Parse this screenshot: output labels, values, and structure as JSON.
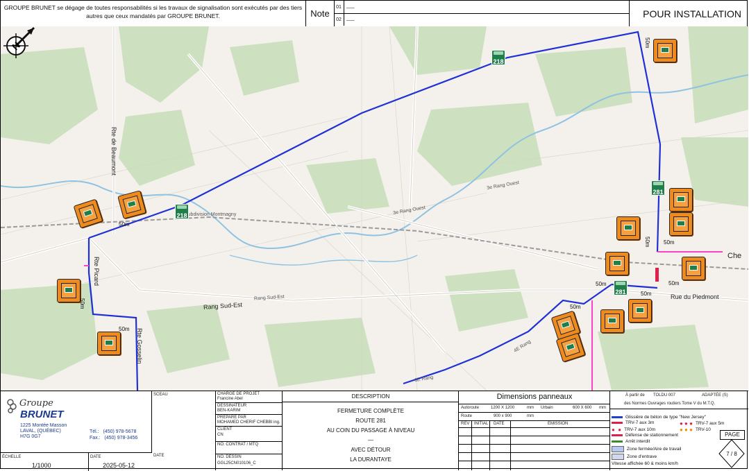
{
  "header": {
    "disclaimer": "GROUPE BRUNET se dégage de toutes responsabilités si les travaux de signalisation sont exécutés par des tiers autres que ceux mandatés par GROUPE BRUNET.",
    "note_label": "Note",
    "note_rows": [
      {
        "num": "01",
        "value": "___"
      },
      {
        "num": "02",
        "value": "___"
      }
    ],
    "status": "POUR INSTALLATION"
  },
  "map": {
    "roads": {
      "rte_beaumont": "Rte de Beaumont",
      "rte_picard": "Rte Picard",
      "rte_gosselin": "Rte Gosselin",
      "rang_sud_est": "Rang Sud-Est",
      "rang_sud_est_small": "Rang Sud-Est",
      "rue_piedmont": "Rue du Piedmont",
      "rang_4e": "4E Rang",
      "rang_6e": "6E Rang",
      "rang_3e": "3e Rang Ouest",
      "chemin": "Che",
      "rang_3e_b": "3e Rang Ouest",
      "railway": "Subdivision Montmagny"
    },
    "route_shields": [
      "218",
      "218",
      "281",
      "281"
    ],
    "dimensions": [
      "50m",
      "50m",
      "50m",
      "50m",
      "50m",
      "50m",
      "50m",
      "50m",
      "50m",
      "50m"
    ],
    "compass_label": "N"
  },
  "title_block": {
    "logo_word": "Groupe",
    "logo_brand": "BRUNET",
    "address_1": "1225 Montée Masson",
    "address_2": "LAVAL, (QUÉBEC)",
    "address_3": "H7G 0G7",
    "tel_label": "Tél.:",
    "tel": "(450) 978-5678",
    "fax_label": "Fax.:",
    "fax": "(450) 978-3456",
    "echelle_label": "ÉCHELLE",
    "echelle": "1/1000",
    "date_label": "DATE",
    "date": "2025-05-12",
    "sceau_label": "SCEAU",
    "date2_label": "DATE",
    "charge_label": "CHARGÉ DE PROJET",
    "charge": "Francine Abel",
    "dessinateur_label": "DESSINATEUR",
    "dessinateur": "BEN-KARIM",
    "prepare_label": "PRÉPARÉ PAR",
    "prepare": "MOHAMED CHERIF CHEBBI ing.",
    "client_label": "CLIENT",
    "client": "CN",
    "contrat_label": "NO. CONTRAT / MTQ",
    "dessin_label": "NO. DESSIN",
    "dessin": "GGL25CN010106_C",
    "description_label": "DESCRIPTION",
    "description_lines": [
      "FERMETURE COMPLÈTE",
      "ROUTE 281",
      "AU COIN DU PASSAGE À NIVEAU",
      "—",
      "AVEC DÉTOUR",
      "LA DURANTAYE"
    ],
    "dimensions_title": "Dimensions panneaux",
    "autoroute_label": "Autoroute",
    "autoroute": "1200 X 1200",
    "mm1": "mm",
    "urbain_label": "Urbain",
    "urbain": "600 X 600",
    "mm2": "mm",
    "route_label": "Route",
    "route": "900 x 900",
    "mm3": "mm",
    "rev_headers": [
      "REV",
      "INITIAL",
      "DATE",
      "ÉMISSION"
    ],
    "partir_label": "À partir de",
    "partir_value": "TOLDU 007",
    "adaptee": "ADAPTÉE (S)",
    "normes": "des Normes Ouvrages routiers Tome V du M.T.Q.",
    "legend": [
      {
        "label": "Glissière de béton de type \"New Jersey\"",
        "color": "#1e3fd6"
      },
      {
        "label": "TRV-7 aux 3m",
        "color": "#e0204c"
      },
      {
        "label": "TRV-7 aux 5m",
        "color": "#e0204c"
      },
      {
        "label": "TRV-7 aux 10m",
        "color": "#e0204c"
      },
      {
        "label": "TRV-10",
        "color": "#f08a00"
      },
      {
        "label": "Défense de stationnement",
        "color": "#e0204c"
      },
      {
        "label": "Arrêt interdit",
        "color": "#3a8c28"
      },
      {
        "label": "Zone fermée/Aire de travail",
        "color": "#b8c8f0"
      },
      {
        "label": "Zone d'entrave",
        "color": "#d0d8f0"
      },
      {
        "label": "Vitesse affichée 60 & moins km/h",
        "color": "#ffffff"
      }
    ],
    "page_label": "PAGE",
    "page": "7 / 8"
  }
}
